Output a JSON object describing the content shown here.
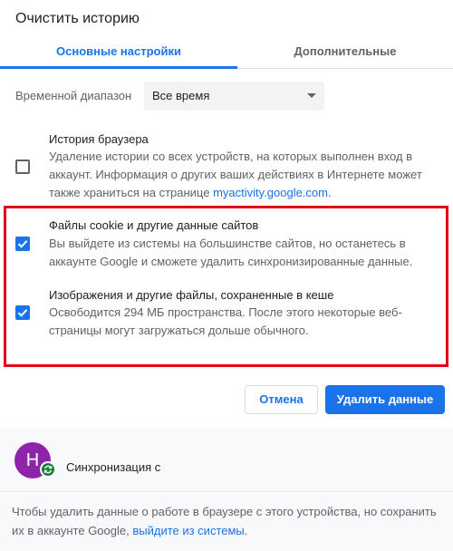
{
  "dialog": {
    "title": "Очистить историю"
  },
  "tabs": [
    {
      "label": "Основные настройки"
    },
    {
      "label": "Дополнительные"
    }
  ],
  "time_range": {
    "label": "Временной диапазон",
    "value": "Все время"
  },
  "options": [
    {
      "title": "История браузера",
      "description": "Удаление истории со всех устройств, на которых выполнен вход в аккаунт. Информация о других ваших действиях в Интернете может также храниться на странице ",
      "link": "myactivity.google.com",
      "description_end": ".",
      "checked": false
    },
    {
      "title": "Файлы cookie и другие данные сайтов",
      "description": "Вы выйдете из системы на большинстве сайтов, но останетесь в аккаунте Google и сможете удалить синхронизированные данные.",
      "checked": true
    },
    {
      "title": "Изображения и другие файлы, сохраненные в кеше",
      "description": "Освободится 294 МБ пространства. После этого некоторые веб-страницы могут загружаться дольше обычного.",
      "checked": true
    }
  ],
  "buttons": {
    "cancel": "Отмена",
    "delete": "Удалить данные"
  },
  "sync": {
    "avatar_letter": "H",
    "text": "Синхронизация с"
  },
  "footer": {
    "note": "Чтобы удалить данные о работе в браузере с этого устройства, но сохранить их в аккаунте Google, ",
    "link": "выйдите из системы",
    "note_end": "."
  },
  "colors": {
    "accent": "#1a73e8",
    "highlight": "#e3051b",
    "avatar": "#8e24aa",
    "sync_badge": "#188038"
  },
  "icons": [
    "dropdown-arrow-icon",
    "checkbox-icon",
    "checkmark-icon",
    "sync-icon"
  ]
}
